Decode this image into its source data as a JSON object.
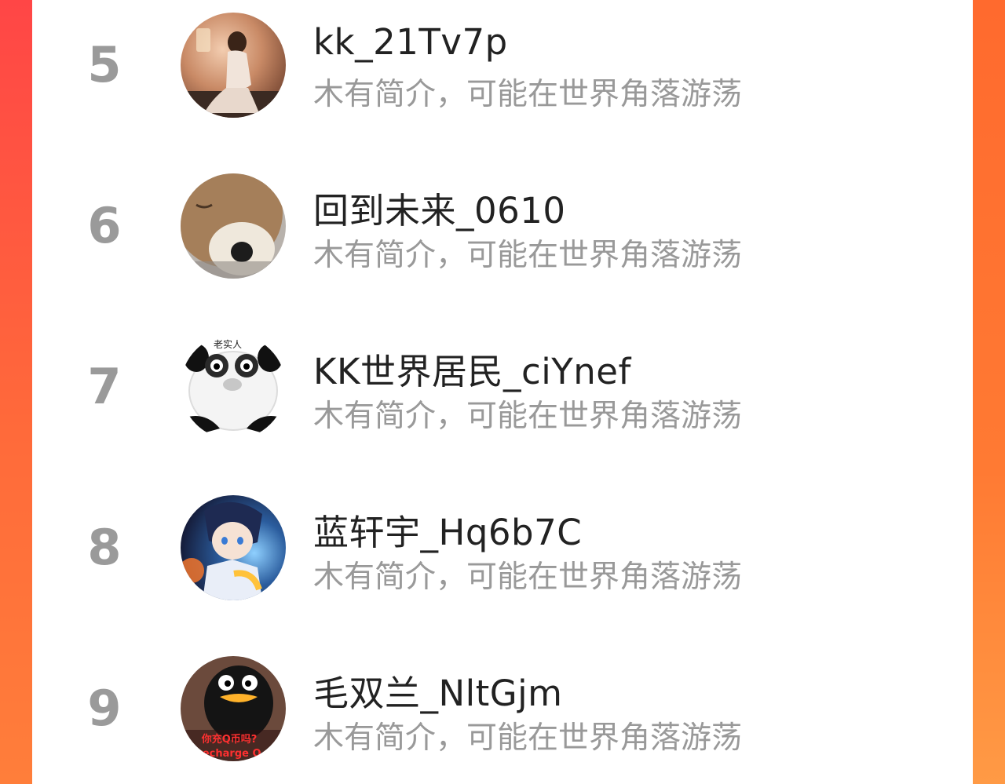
{
  "colors": {
    "background_gradient_top": "#ff4646",
    "background_gradient_bottom": "#ff7e3a",
    "card": "#ffffff",
    "rank_text": "#9a9a9a",
    "name_text": "#222222",
    "bio_text": "#999999"
  },
  "ranking_list": {
    "items": [
      {
        "rank": "5",
        "name": "kk_21Tv7p",
        "bio": "木有简介，可能在世界角落游荡",
        "avatar_icon": "user-photo-avatar"
      },
      {
        "rank": "6",
        "name": "回到未来_0610",
        "bio": "木有简介，可能在世界角落游荡",
        "avatar_icon": "plush-bear-avatar"
      },
      {
        "rank": "7",
        "name": "KK世界居民_ciYnef",
        "bio": "木有简介，可能在世界角落游荡",
        "avatar_icon": "panda-meme-avatar",
        "avatar_text": "老实人"
      },
      {
        "rank": "8",
        "name": "蓝轩宇_Hq6b7C",
        "bio": "木有简介，可能在世界角落游荡",
        "avatar_icon": "anime-character-avatar"
      },
      {
        "rank": "9",
        "name": "毛双兰_NltGjm",
        "bio": "木有简介，可能在世界角落游荡",
        "avatar_icon": "penguin-meme-avatar",
        "avatar_text": "你充Q币吗?",
        "avatar_text_2": "recharge Q"
      }
    ]
  }
}
